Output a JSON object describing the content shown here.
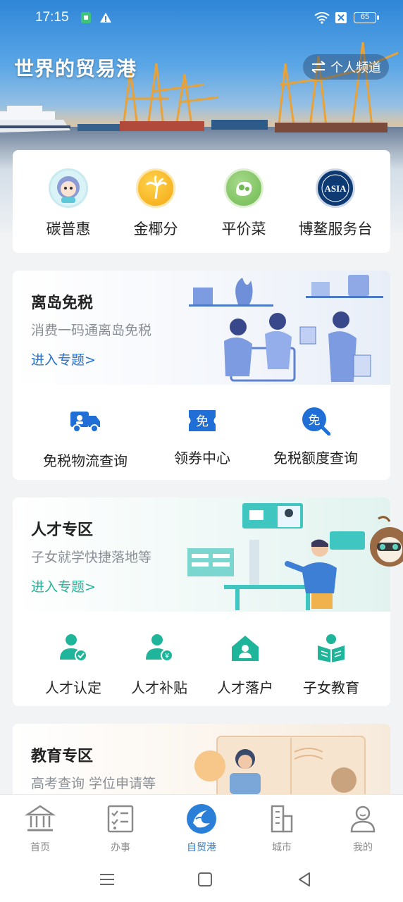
{
  "status_bar": {
    "time": "17:15",
    "battery": "65"
  },
  "header": {
    "title": "世界的贸易港",
    "channel_button": "个人频道"
  },
  "quick_links": [
    {
      "label": "碳普惠",
      "icon": "mascot-icon"
    },
    {
      "label": "金椰分",
      "icon": "palm-tree-icon"
    },
    {
      "label": "平价菜",
      "icon": "vegetable-icon"
    },
    {
      "label": "博鳌服务台",
      "icon": "asia-logo-icon"
    }
  ],
  "duty_free": {
    "title": "离岛免税",
    "subtitle": "消费一码通离岛免税",
    "link": "进入专题>",
    "actions": [
      {
        "label": "免税物流查询",
        "icon": "truck-icon"
      },
      {
        "label": "领券中心",
        "icon": "coupon-icon",
        "badge": "免"
      },
      {
        "label": "免税额度查询",
        "icon": "search-quota-icon",
        "badge": "免"
      }
    ]
  },
  "talent": {
    "title": "人才专区",
    "subtitle": "子女就学快捷落地等",
    "link": "进入专题>",
    "actions": [
      {
        "label": "人才认定",
        "icon": "person-check-icon"
      },
      {
        "label": "人才补贴",
        "icon": "person-money-icon"
      },
      {
        "label": "人才落户",
        "icon": "house-person-icon"
      },
      {
        "label": "子女教育",
        "icon": "child-book-icon"
      }
    ]
  },
  "education": {
    "title": "教育专区",
    "subtitle": "高考查询 学位申请等"
  },
  "tabbar": {
    "items": [
      {
        "label": "首页",
        "icon": "home-building-icon",
        "active": false
      },
      {
        "label": "办事",
        "icon": "checklist-icon",
        "active": false
      },
      {
        "label": "自贸港",
        "icon": "free-trade-port-icon",
        "active": true
      },
      {
        "label": "城市",
        "icon": "city-icon",
        "active": false
      },
      {
        "label": "我的",
        "icon": "profile-icon",
        "active": false
      }
    ]
  },
  "colors": {
    "primary_blue": "#1f6fd6",
    "teal": "#1fb59a",
    "active_tab": "#2a7fd8"
  }
}
